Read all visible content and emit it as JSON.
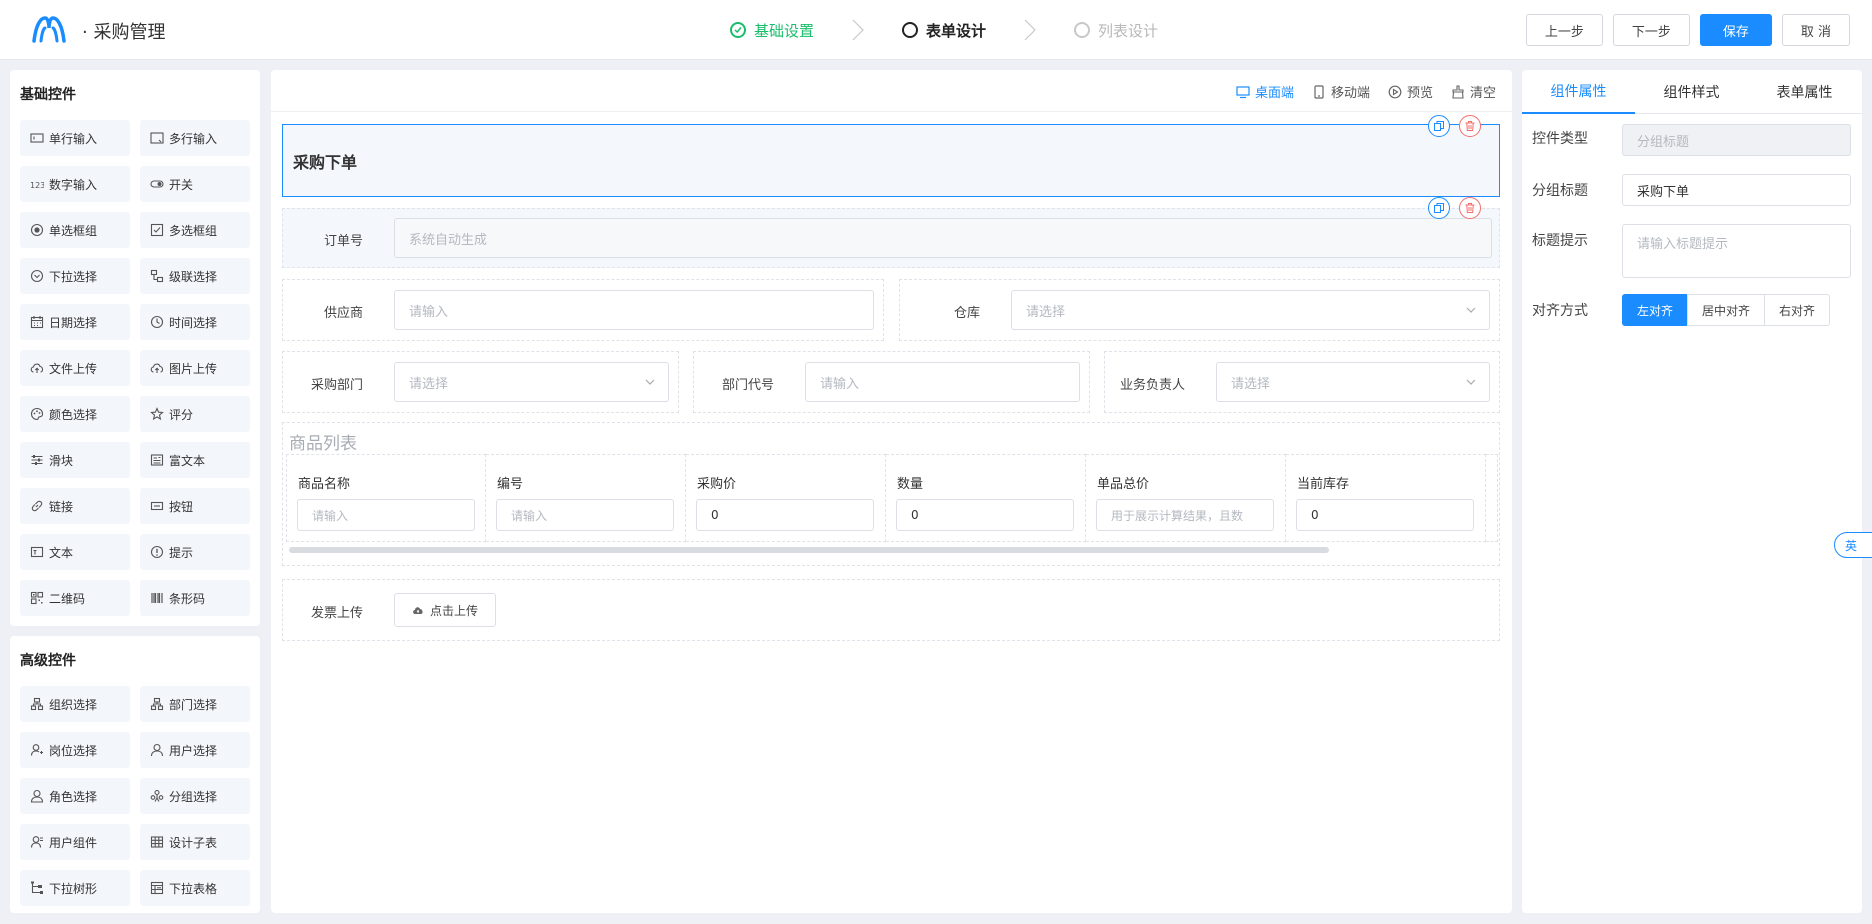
{
  "header": {
    "app_title": "· 采购管理",
    "steps": [
      {
        "label": "基础设置",
        "state": "done"
      },
      {
        "label": "表单设计",
        "state": "active"
      },
      {
        "label": "列表设计",
        "state": "todo"
      }
    ],
    "buttons": {
      "prev": "上一步",
      "next": "下一步",
      "save": "保存",
      "cancel": "取 消"
    }
  },
  "basic_widgets": {
    "title": "基础控件",
    "items": [
      {
        "label": "单行输入",
        "icon": "single-line-icon"
      },
      {
        "label": "多行输入",
        "icon": "multi-line-icon"
      },
      {
        "label": "数字输入",
        "icon": "number-icon"
      },
      {
        "label": "开关",
        "icon": "switch-icon"
      },
      {
        "label": "单选框组",
        "icon": "radio-icon"
      },
      {
        "label": "多选框组",
        "icon": "checkbox-icon"
      },
      {
        "label": "下拉选择",
        "icon": "dropdown-icon"
      },
      {
        "label": "级联选择",
        "icon": "cascader-icon"
      },
      {
        "label": "日期选择",
        "icon": "calendar-icon"
      },
      {
        "label": "时间选择",
        "icon": "clock-icon"
      },
      {
        "label": "文件上传",
        "icon": "upload-icon"
      },
      {
        "label": "图片上传",
        "icon": "image-upload-icon"
      },
      {
        "label": "颜色选择",
        "icon": "palette-icon"
      },
      {
        "label": "评分",
        "icon": "star-icon"
      },
      {
        "label": "滑块",
        "icon": "slider-icon"
      },
      {
        "label": "富文本",
        "icon": "rich-text-icon"
      },
      {
        "label": "链接",
        "icon": "link-icon"
      },
      {
        "label": "按钮",
        "icon": "button-icon"
      },
      {
        "label": "文本",
        "icon": "text-icon"
      },
      {
        "label": "提示",
        "icon": "info-icon"
      },
      {
        "label": "二维码",
        "icon": "qrcode-icon"
      },
      {
        "label": "条形码",
        "icon": "barcode-icon"
      }
    ]
  },
  "advanced_widgets": {
    "title": "高级控件",
    "items": [
      {
        "label": "组织选择",
        "icon": "org-icon"
      },
      {
        "label": "部门选择",
        "icon": "dept-icon"
      },
      {
        "label": "岗位选择",
        "icon": "post-icon"
      },
      {
        "label": "用户选择",
        "icon": "user-icon"
      },
      {
        "label": "角色选择",
        "icon": "role-icon"
      },
      {
        "label": "分组选择",
        "icon": "group-icon"
      },
      {
        "label": "用户组件",
        "icon": "user-comp-icon"
      },
      {
        "label": "设计子表",
        "icon": "table-icon"
      },
      {
        "label": "下拉树形",
        "icon": "tree-icon"
      },
      {
        "label": "下拉表格",
        "icon": "grid-table-icon"
      }
    ]
  },
  "canvas": {
    "toolbar": {
      "desktop": "桌面端",
      "mobile": "移动端",
      "preview": "预览",
      "clear": "清空"
    },
    "group_title": "采购下单",
    "order_no": {
      "label": "订单号",
      "placeholder": "系统自动生成"
    },
    "supplier": {
      "label": "供应商",
      "placeholder": "请输入"
    },
    "warehouse": {
      "label": "仓库",
      "placeholder": "请选择"
    },
    "dept": {
      "label": "采购部门",
      "placeholder": "请选择"
    },
    "dept_code": {
      "label": "部门代号",
      "placeholder": "请输入"
    },
    "owner": {
      "label": "业务负责人",
      "placeholder": "请选择"
    },
    "goods": {
      "title": "商品列表",
      "columns": [
        {
          "header": "商品名称",
          "value": "请输入",
          "is_placeholder": true
        },
        {
          "header": "编号",
          "value": "请输入",
          "is_placeholder": true
        },
        {
          "header": "采购价",
          "value": "0",
          "is_placeholder": false
        },
        {
          "header": "数量",
          "value": "0",
          "is_placeholder": false
        },
        {
          "header": "单品总价",
          "value": "用于展示计算结果，且数",
          "is_placeholder": true
        },
        {
          "header": "当前库存",
          "value": "0",
          "is_placeholder": false
        }
      ]
    },
    "invoice": {
      "label": "发票上传",
      "button": "点击上传"
    }
  },
  "props_panel": {
    "tabs": [
      "组件属性",
      "组件样式",
      "表单属性"
    ],
    "control_type": {
      "label": "控件类型",
      "value": "分组标题"
    },
    "group_title": {
      "label": "分组标题",
      "value": "采购下单"
    },
    "title_hint": {
      "label": "标题提示",
      "placeholder": "请输入标题提示"
    },
    "align": {
      "label": "对齐方式",
      "options": [
        "左对齐",
        "居中对齐",
        "右对齐"
      ],
      "selected": "左对齐"
    }
  },
  "lang_toggle": "英",
  "colors": {
    "accent": "#1a8cff",
    "success": "#19be6b",
    "danger": "#f56c6c"
  }
}
